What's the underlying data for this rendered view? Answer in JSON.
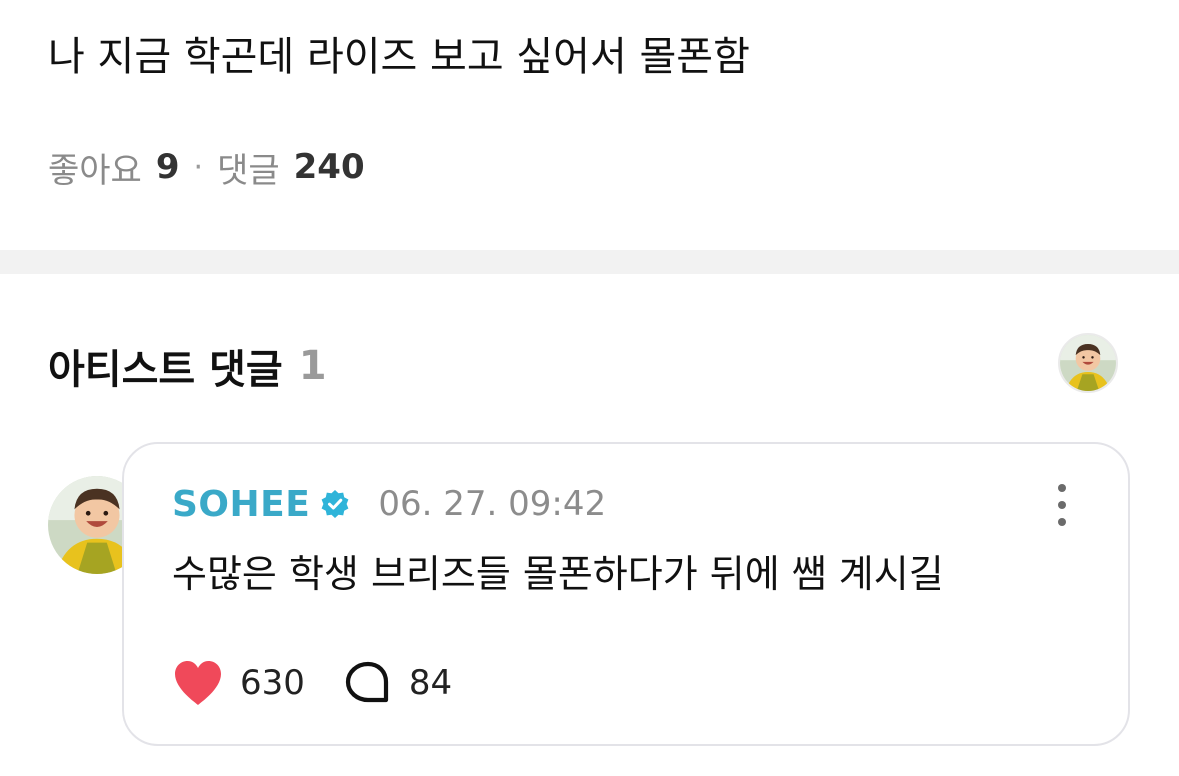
{
  "post": {
    "body": "나 지금 학곤데 라이즈 보고 싶어서 몰폰함",
    "likes_label": "좋아요",
    "likes_count": "9",
    "separator": "·",
    "comments_label": "댓글",
    "comments_count": "240"
  },
  "artist_comments": {
    "title": "아티스트 댓글",
    "count": "1",
    "header_avatar_icon": "artist-profile-avatar"
  },
  "comment": {
    "author": "SOHEE",
    "verified_icon": "verified-badge-icon",
    "timestamp": "06. 27. 09:42",
    "text": "수많은 학생 브리즈들 몰폰하다가 뒤에 쌤 계시길",
    "likes": "630",
    "replies": "84",
    "like_icon": "heart-icon",
    "reply_icon": "speech-bubble-icon",
    "more_icon": "more-vertical-icon"
  },
  "colors": {
    "author": "#3aa9c8",
    "verified": "#2fb4d9",
    "heart": "#f0495a",
    "divider": "#f2f2f2",
    "card_border": "#e3e3e8"
  }
}
